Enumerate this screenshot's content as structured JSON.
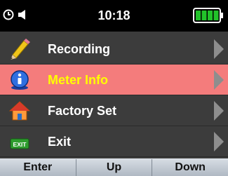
{
  "status": {
    "time": "10:18",
    "clock_icon": "clock-icon",
    "speaker_icon": "speaker-icon",
    "battery_icon": "battery-full-icon",
    "battery_level": 1.0,
    "battery_color": "#22c22a"
  },
  "menu": {
    "selected_color": "#f47c7c",
    "selected_text_color": "#ffff00",
    "items": [
      {
        "label": "Recording",
        "icon": "pencil-icon"
      },
      {
        "label": "Meter Info",
        "icon": "info-icon",
        "selected": true
      },
      {
        "label": "Factory Set",
        "icon": "home-icon"
      },
      {
        "label": "Exit",
        "icon": "exit-icon"
      }
    ]
  },
  "softkeys": {
    "enter": "Enter",
    "up": "Up",
    "down": "Down"
  }
}
